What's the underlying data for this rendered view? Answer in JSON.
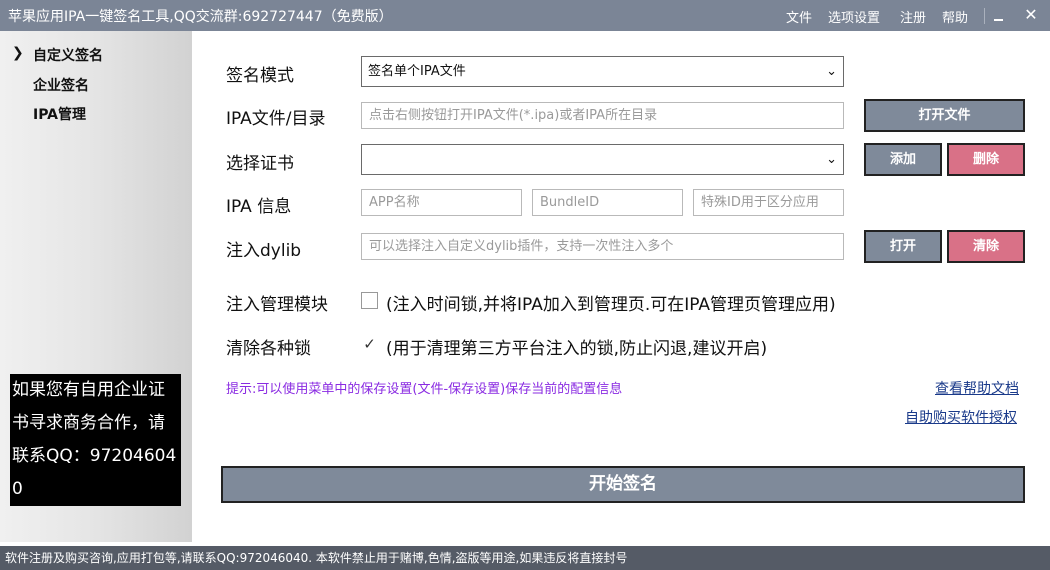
{
  "window": {
    "title": "苹果应用IPA一键签名工具,QQ交流群:692727447（免费版）",
    "menu": [
      "文件",
      "选项设置",
      "注册",
      "帮助"
    ],
    "minimize_glyph": "",
    "close_glyph": "✕"
  },
  "sidebar": {
    "items": [
      {
        "label": "自定义签名",
        "selected": true
      },
      {
        "label": "企业签名",
        "selected": false
      },
      {
        "label": "IPA管理",
        "selected": false
      }
    ],
    "selected_marker": "❯",
    "promo_text": "如果您有自用企业证书寻求商务合作，请联系QQ：972046040"
  },
  "form": {
    "sign_mode": {
      "label": "签名模式",
      "value": "签名单个IPA文件"
    },
    "ipa_file": {
      "label": "IPA文件/目录",
      "placeholder": "点击右侧按钮打开IPA文件(*.ipa)或者IPA所在目录",
      "button": "打开文件"
    },
    "certificate": {
      "label": "选择证书",
      "value": "",
      "add_button": "添加",
      "delete_button": "删除"
    },
    "ipa_info": {
      "label": "IPA 信息",
      "app_name_placeholder": "APP名称",
      "bundle_id_placeholder": "BundleID",
      "special_id_placeholder": "特殊ID用于区分应用"
    },
    "dylib": {
      "label": "注入dylib",
      "placeholder": "可以选择注入自定义dylib插件，支持一次性注入多个",
      "open_button": "打开",
      "clear_button": "清除"
    },
    "inject_module": {
      "label": "注入管理模块",
      "checked": false,
      "description": "(注入时间锁,并将IPA加入到管理页.可在IPA管理页管理应用)"
    },
    "clear_locks": {
      "label": "清除各种锁",
      "checked": true,
      "description": "(用于清理第三方平台注入的锁,防止闪退,建议开启)"
    }
  },
  "hint": "提示:可以使用菜单中的保存设置(文件-保存设置)保存当前的配置信息",
  "links": {
    "help": "查看帮助文档",
    "buy": "自助购买软件授权"
  },
  "start_button": "开始签名",
  "status_bar": "软件注册及购买咨询,应用打包等,请联系QQ:972046040.  本软件禁止用于赌博,色情,盗版等用途,如果违反将直接封号",
  "colors": {
    "titlebar": "#7b8596",
    "button_gray": "#7f8a9a",
    "button_pink": "#d97187",
    "hint": "#8a2be2",
    "link": "#1a3a8a",
    "statusbar": "#555b66"
  }
}
